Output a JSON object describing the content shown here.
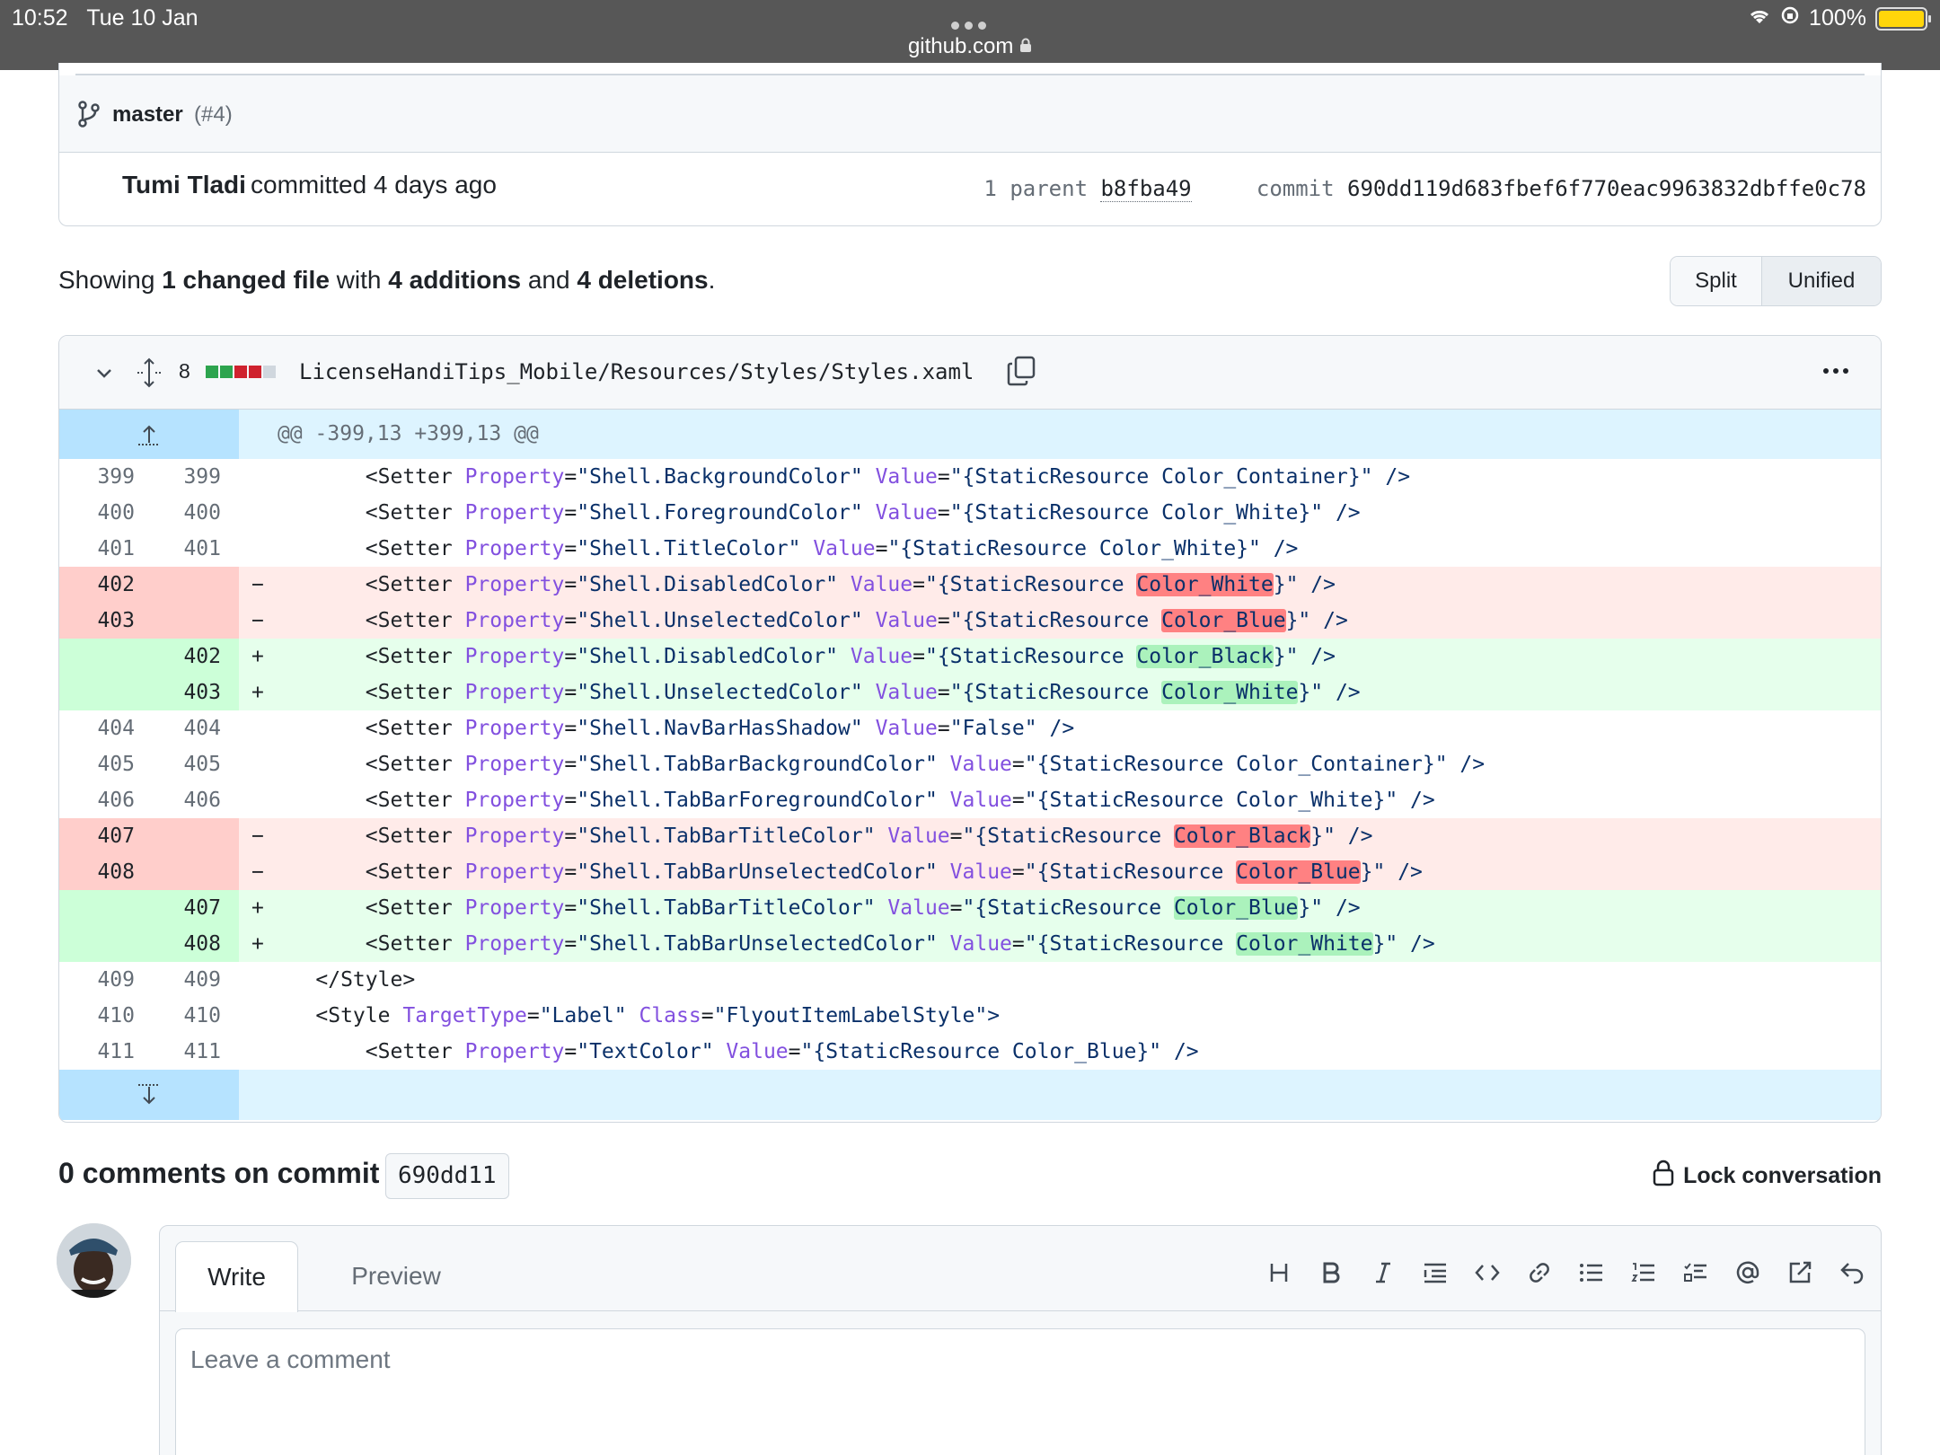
{
  "status_bar": {
    "time": "10:52",
    "date": "Tue 10 Jan",
    "url": "github.com",
    "battery": "100%"
  },
  "commit": {
    "branch": "master",
    "pr": "(#4)",
    "author": "Tumi Tladi",
    "committed": "committed 4 days ago",
    "parent_label": "1 parent",
    "parent_sha": "b8fba49",
    "commit_label": "commit",
    "commit_sha": "690dd119d683fbef6f770eac9963832dbffe0c78"
  },
  "summary": {
    "prefix": "Showing ",
    "changed": "1 changed file",
    "with": " with ",
    "additions": "4 additions",
    "and": " and ",
    "deletions": "4 deletions",
    "end": "."
  },
  "view_toggle": {
    "split": "Split",
    "unified": "Unified"
  },
  "diff": {
    "changes": "8",
    "file_path": "LicenseHandiTips_Mobile/Resources/Styles/Styles.xaml",
    "hunk_header": "@@ -399,13 +399,13 @@",
    "rows": [
      {
        "type": "ctx",
        "old": "399",
        "new": "399",
        "sign": "",
        "indent": "        ",
        "tag": "<Setter",
        "a1": "Property",
        "v1": "\"Shell.BackgroundColor\"",
        "a2": "Value",
        "pre": "\"{StaticResource ",
        "hl": "",
        "plain": "Color_Container",
        "post": "}\" />"
      },
      {
        "type": "ctx",
        "old": "400",
        "new": "400",
        "sign": "",
        "indent": "        ",
        "tag": "<Setter",
        "a1": "Property",
        "v1": "\"Shell.ForegroundColor\"",
        "a2": "Value",
        "pre": "\"{StaticResource ",
        "hl": "",
        "plain": "Color_White",
        "post": "}\" />"
      },
      {
        "type": "ctx",
        "old": "401",
        "new": "401",
        "sign": "",
        "indent": "        ",
        "tag": "<Setter",
        "a1": "Property",
        "v1": "\"Shell.TitleColor\"",
        "a2": "Value",
        "pre": "\"{StaticResource ",
        "hl": "",
        "plain": "Color_White",
        "post": "}\" />"
      },
      {
        "type": "del",
        "old": "402",
        "new": "",
        "sign": "−",
        "indent": "        ",
        "tag": "<Setter",
        "a1": "Property",
        "v1": "\"Shell.DisabledColor\"",
        "a2": "Value",
        "pre": "\"{StaticResource ",
        "hl": "Color_White",
        "plain": "",
        "post": "}\" />"
      },
      {
        "type": "del",
        "old": "403",
        "new": "",
        "sign": "−",
        "indent": "        ",
        "tag": "<Setter",
        "a1": "Property",
        "v1": "\"Shell.UnselectedColor\"",
        "a2": "Value",
        "pre": "\"{StaticResource ",
        "hl": "Color_Blue",
        "plain": "",
        "post": "}\" />"
      },
      {
        "type": "add",
        "old": "",
        "new": "402",
        "sign": "+",
        "indent": "        ",
        "tag": "<Setter",
        "a1": "Property",
        "v1": "\"Shell.DisabledColor\"",
        "a2": "Value",
        "pre": "\"{StaticResource ",
        "hl": "Color_Black",
        "plain": "",
        "post": "}\" />"
      },
      {
        "type": "add",
        "old": "",
        "new": "403",
        "sign": "+",
        "indent": "        ",
        "tag": "<Setter",
        "a1": "Property",
        "v1": "\"Shell.UnselectedColor\"",
        "a2": "Value",
        "pre": "\"{StaticResource ",
        "hl": "Color_White",
        "plain": "",
        "post": "}\" />"
      },
      {
        "type": "ctx",
        "old": "404",
        "new": "404",
        "sign": "",
        "indent": "        ",
        "tag": "<Setter",
        "a1": "Property",
        "v1": "\"Shell.NavBarHasShadow\"",
        "a2": "Value",
        "pre": "\"False\"",
        "hl": "",
        "plain": "",
        "post": " />"
      },
      {
        "type": "ctx",
        "old": "405",
        "new": "405",
        "sign": "",
        "indent": "        ",
        "tag": "<Setter",
        "a1": "Property",
        "v1": "\"Shell.TabBarBackgroundColor\"",
        "a2": "Value",
        "pre": "\"{StaticResource ",
        "hl": "",
        "plain": "Color_Container",
        "post": "}\" />"
      },
      {
        "type": "ctx",
        "old": "406",
        "new": "406",
        "sign": "",
        "indent": "        ",
        "tag": "<Setter",
        "a1": "Property",
        "v1": "\"Shell.TabBarForegroundColor\"",
        "a2": "Value",
        "pre": "\"{StaticResource ",
        "hl": "",
        "plain": "Color_White",
        "post": "}\" />"
      },
      {
        "type": "del",
        "old": "407",
        "new": "",
        "sign": "−",
        "indent": "        ",
        "tag": "<Setter",
        "a1": "Property",
        "v1": "\"Shell.TabBarTitleColor\"",
        "a2": "Value",
        "pre": "\"{StaticResource ",
        "hl": "Color_Black",
        "plain": "",
        "post": "}\" />"
      },
      {
        "type": "del",
        "old": "408",
        "new": "",
        "sign": "−",
        "indent": "        ",
        "tag": "<Setter",
        "a1": "Property",
        "v1": "\"Shell.TabBarUnselectedColor\"",
        "a2": "Value",
        "pre": "\"{StaticResource ",
        "hl": "Color_Blue",
        "plain": "",
        "post": "}\" />"
      },
      {
        "type": "add",
        "old": "",
        "new": "407",
        "sign": "+",
        "indent": "        ",
        "tag": "<Setter",
        "a1": "Property",
        "v1": "\"Shell.TabBarTitleColor\"",
        "a2": "Value",
        "pre": "\"{StaticResource ",
        "hl": "Color_Blue",
        "plain": "",
        "post": "}\" />"
      },
      {
        "type": "add",
        "old": "",
        "new": "408",
        "sign": "+",
        "indent": "        ",
        "tag": "<Setter",
        "a1": "Property",
        "v1": "\"Shell.TabBarUnselectedColor\"",
        "a2": "Value",
        "pre": "\"{StaticResource ",
        "hl": "Color_White",
        "plain": "",
        "post": "}\" />"
      },
      {
        "type": "ctx",
        "old": "409",
        "new": "409",
        "sign": "",
        "indent": "    ",
        "tag": "</Style>",
        "a1": "",
        "v1": "",
        "a2": "",
        "pre": "",
        "hl": "",
        "plain": "",
        "post": ""
      },
      {
        "type": "ctx",
        "old": "410",
        "new": "410",
        "sign": "",
        "indent": "    ",
        "tag": "<Style",
        "a1": "TargetType",
        "v1": "\"Label\"",
        "a2": "Class",
        "pre": "\"FlyoutItemLabelStyle\"",
        "hl": "",
        "plain": "",
        "post": ">"
      },
      {
        "type": "ctx",
        "old": "411",
        "new": "411",
        "sign": "",
        "indent": "        ",
        "tag": "<Setter",
        "a1": "Property",
        "v1": "\"TextColor\"",
        "a2": "Value",
        "pre": "\"{StaticResource ",
        "hl": "",
        "plain": "Color_Blue",
        "post": "}\" />"
      }
    ]
  },
  "comments": {
    "title": "0 comments on commit",
    "sha": "690dd11",
    "lock": "Lock conversation",
    "tab_write": "Write",
    "tab_preview": "Preview",
    "placeholder": "Leave a comment"
  },
  "colors": {
    "additions": "#2da44e",
    "deletions": "#cf222e",
    "neutral": "#d0d7de",
    "attr": "#8250df",
    "string": "#0a3069"
  },
  "diffstat_blocks": [
    "add",
    "add",
    "del",
    "del",
    "neutral"
  ]
}
